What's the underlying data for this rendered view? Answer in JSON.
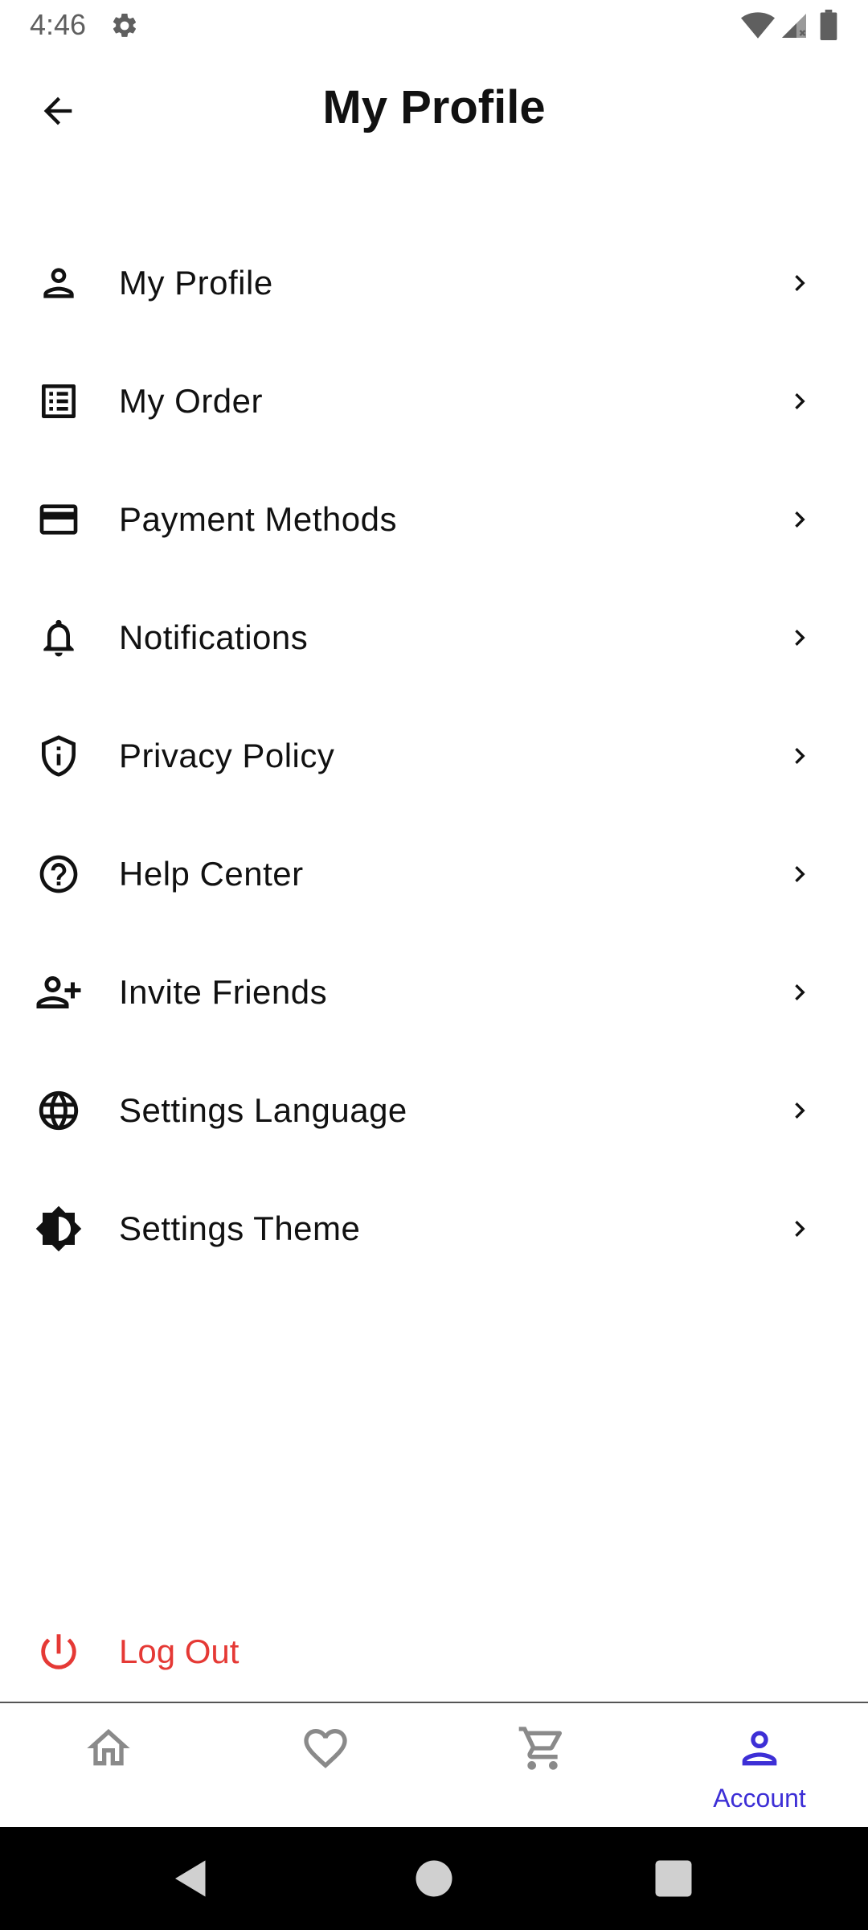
{
  "status_bar": {
    "time": "4:46",
    "icons": [
      "gear-icon",
      "wifi-icon",
      "signal-icon",
      "battery-icon"
    ]
  },
  "header": {
    "title": "My Profile",
    "back_icon": "arrow-back-icon"
  },
  "menu": {
    "items": [
      {
        "label": "My Profile",
        "icon": "person-icon"
      },
      {
        "label": "My Order",
        "icon": "list-alt-icon"
      },
      {
        "label": "Payment Methods",
        "icon": "credit-card-icon"
      },
      {
        "label": "Notifications",
        "icon": "bell-icon"
      },
      {
        "label": "Privacy Policy",
        "icon": "shield-icon"
      },
      {
        "label": "Help Center",
        "icon": "help-circle-icon"
      },
      {
        "label": "Invite Friends",
        "icon": "person-add-icon"
      },
      {
        "label": "Settings Language",
        "icon": "globe-icon"
      },
      {
        "label": "Settings Theme",
        "icon": "brightness-icon"
      }
    ]
  },
  "logout": {
    "label": "Log Out",
    "icon": "power-icon",
    "color": "#e53935"
  },
  "bottom_nav": {
    "items": [
      {
        "icon": "home-icon",
        "label": "",
        "active": false
      },
      {
        "icon": "heart-icon",
        "label": "",
        "active": false
      },
      {
        "icon": "cart-icon",
        "label": "",
        "active": false
      },
      {
        "icon": "account-icon",
        "label": "Account",
        "active": true
      }
    ],
    "active_color": "#3d2fd6",
    "inactive_color": "#8a8a8a"
  },
  "system_nav": {
    "icons": [
      "back-triangle-icon",
      "home-circle-icon",
      "recents-square-icon"
    ]
  }
}
